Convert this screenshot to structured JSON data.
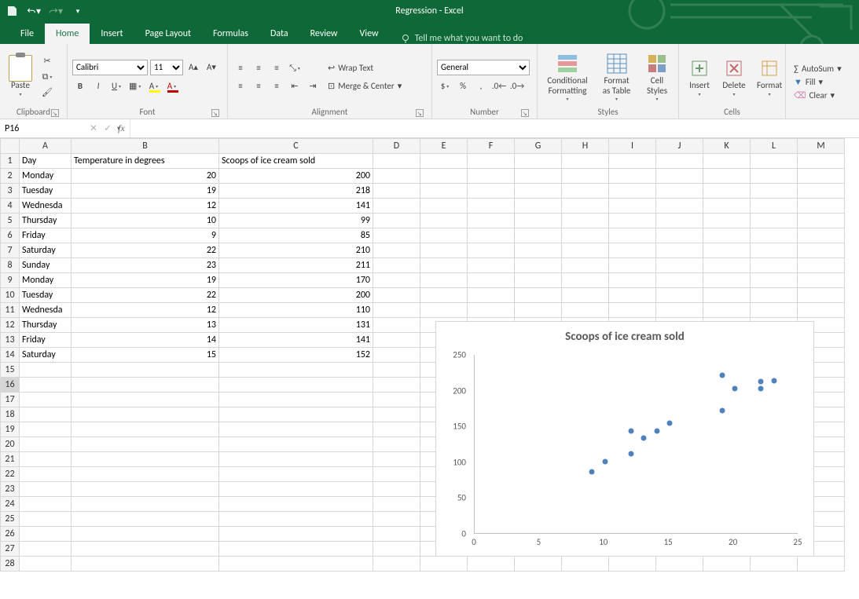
{
  "app": {
    "title": "Regression - Excel"
  },
  "tabs": {
    "file": "File",
    "home": "Home",
    "insert": "Insert",
    "pagelayout": "Page Layout",
    "formulas": "Formulas",
    "data": "Data",
    "review": "Review",
    "view": "View",
    "tellme": "Tell me what you want to do"
  },
  "ribbon": {
    "clipboard": {
      "label": "Clipboard",
      "paste": "Paste"
    },
    "font": {
      "label": "Font",
      "name": "Calibri",
      "size": "11"
    },
    "alignment": {
      "label": "Alignment",
      "wrap": "Wrap Text",
      "merge": "Merge & Center"
    },
    "number": {
      "label": "Number",
      "format": "General"
    },
    "styles": {
      "label": "Styles",
      "cond": "Conditional Formatting",
      "fmt": "Format as Table",
      "cell": "Cell Styles"
    },
    "cells": {
      "label": "Cells",
      "insert": "Insert",
      "delete": "Delete",
      "format": "Format"
    },
    "editing": {
      "autosum": "AutoSum",
      "fill": "Fill",
      "clear": "Clear"
    }
  },
  "namebox": "P16",
  "columns": [
    "A",
    "B",
    "C",
    "D",
    "E",
    "F",
    "G",
    "H",
    "I",
    "J",
    "K",
    "L",
    "M"
  ],
  "headers": {
    "A": "Day",
    "B": "Temperature in degrees",
    "C": "Scoops of ice cream sold"
  },
  "rows": [
    {
      "A": "Monday",
      "B": 20,
      "C": 200
    },
    {
      "A": "Tuesday",
      "B": 19,
      "C": 218
    },
    {
      "A": "Wednesday",
      "B": 12,
      "C": 141
    },
    {
      "A": "Thursday",
      "B": 10,
      "C": 99
    },
    {
      "A": "Friday",
      "B": 9,
      "C": 85
    },
    {
      "A": "Saturday",
      "B": 22,
      "C": 210
    },
    {
      "A": "Sunday",
      "B": 23,
      "C": 211
    },
    {
      "A": "Monday",
      "B": 19,
      "C": 170
    },
    {
      "A": "Tuesday",
      "B": 22,
      "C": 200
    },
    {
      "A": "Wednesday",
      "B": 12,
      "C": 110
    },
    {
      "A": "Thursday",
      "B": 13,
      "C": 131
    },
    {
      "A": "Friday",
      "B": 14,
      "C": 141
    },
    {
      "A": "Saturday",
      "B": 15,
      "C": 152
    }
  ],
  "selection": {
    "row": 16,
    "col": "P"
  },
  "chart_data": {
    "type": "scatter",
    "title": "Scoops of ice cream sold",
    "x": [
      20,
      19,
      12,
      10,
      9,
      22,
      23,
      19,
      22,
      12,
      13,
      14,
      15
    ],
    "y": [
      200,
      218,
      141,
      99,
      85,
      210,
      211,
      170,
      200,
      110,
      131,
      141,
      152
    ],
    "xlim": [
      0,
      25
    ],
    "ylim": [
      0,
      250
    ],
    "xticks": [
      0,
      5,
      10,
      15,
      20,
      25
    ],
    "yticks": [
      0,
      50,
      100,
      150,
      200,
      250
    ]
  }
}
